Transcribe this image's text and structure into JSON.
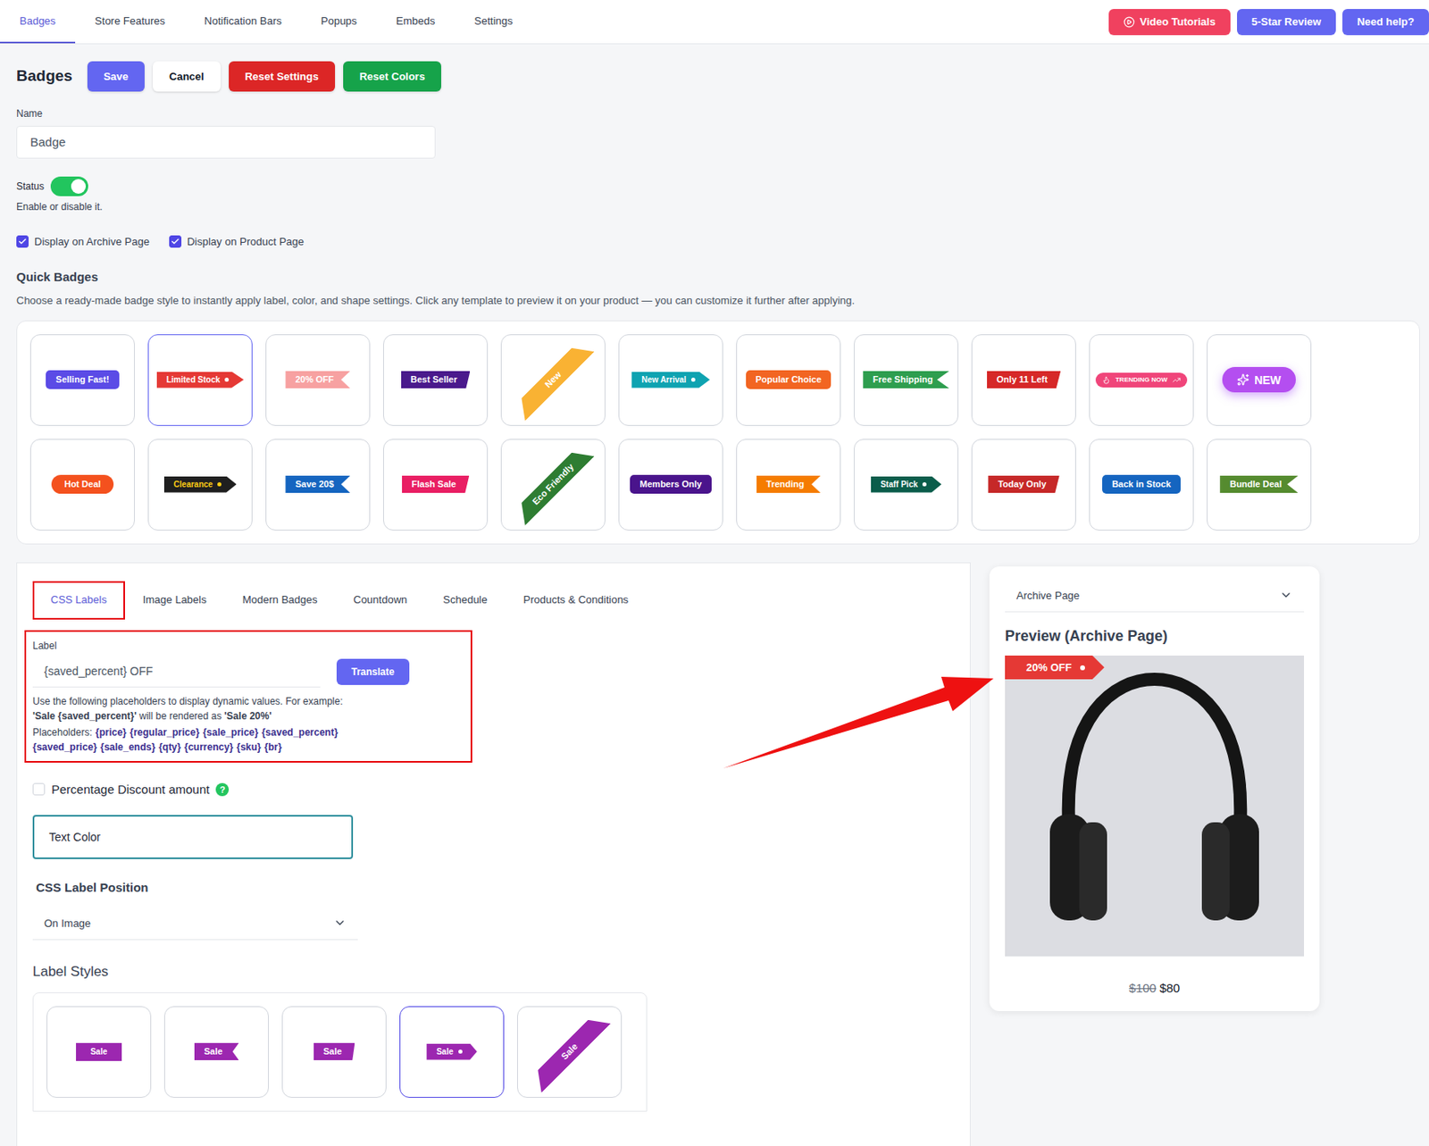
{
  "nav": {
    "tabs": [
      {
        "label": "Badges",
        "selected": true
      },
      {
        "label": "Store Features",
        "selected": false
      },
      {
        "label": "Notification Bars",
        "selected": false
      },
      {
        "label": "Popups",
        "selected": false
      },
      {
        "label": "Embeds",
        "selected": false
      },
      {
        "label": "Settings",
        "selected": false
      }
    ],
    "actions": [
      {
        "label": "Video Tutorials",
        "color": "#f0415f"
      },
      {
        "label": "5-Star Review",
        "color": "#6366f1"
      },
      {
        "label": "Need help?",
        "color": "#6366f1"
      }
    ]
  },
  "header": {
    "title": "Badges",
    "buttons": [
      {
        "label": "Save",
        "color": "#6366f1",
        "text_color": "#ffffff"
      },
      {
        "label": "Cancel",
        "color": "#ffffff",
        "text_color": "#111827"
      },
      {
        "label": "Reset Settings",
        "color": "#dc2626",
        "text_color": "#ffffff"
      },
      {
        "label": "Reset Colors",
        "color": "#16a34a",
        "text_color": "#ffffff"
      }
    ]
  },
  "name_field": {
    "label": "Name",
    "value": "Badge"
  },
  "status": {
    "label": "Status",
    "on": true,
    "hint": "Enable or disable it."
  },
  "display_options": [
    {
      "label": "Display on Archive Page",
      "checked": true
    },
    {
      "label": "Display on Product Page",
      "checked": true
    }
  ],
  "quick_badges": {
    "title": "Quick Badges",
    "description": "Choose a ready-made badge style to instantly apply label, color, and shape settings. Click any template to preview it on your product — you can customize it further after applying.",
    "items": [
      {
        "label": "Selling Fast!",
        "kind": "rounded",
        "color": "#5b4be6",
        "text_color": "#ffffff",
        "selected": false
      },
      {
        "label": "Limited Stock",
        "kind": "arrow",
        "color": "#e53935",
        "text_color": "#ffffff",
        "selected": true
      },
      {
        "label": "20% OFF",
        "kind": "notch",
        "color": "#f7a1a1",
        "text_color": "#ffffff",
        "selected": false
      },
      {
        "label": "Best Seller",
        "kind": "slant",
        "color": "#4a1a8c",
        "text_color": "#ffffff",
        "selected": false
      },
      {
        "label": "New",
        "kind": "corner",
        "color": "#f9b233",
        "text_color": "#ffffff",
        "selected": false
      },
      {
        "label": "New Arrival",
        "kind": "arrow",
        "color": "#0fa3b1",
        "text_color": "#ffffff",
        "selected": false
      },
      {
        "label": "Popular Choice",
        "kind": "rounded",
        "color": "#f26522",
        "text_color": "#ffffff",
        "selected": false
      },
      {
        "label": "Free Shipping",
        "kind": "notch",
        "color": "#2e9e4f",
        "text_color": "#ffffff",
        "selected": false
      },
      {
        "label": "Only 11 Left",
        "kind": "slant",
        "color": "#d62828",
        "text_color": "#ffffff",
        "selected": false
      },
      {
        "label": "TRENDING NOW",
        "kind": "pill-icons",
        "color": "#f0457a",
        "text_color": "#ffffff",
        "selected": false
      },
      {
        "label": "NEW",
        "kind": "pill-glow",
        "color": "#b44ef0",
        "text_color": "#ffffff",
        "selected": false
      },
      {
        "label": "Hot Deal",
        "kind": "pill",
        "color": "#f4511e",
        "text_color": "#ffffff",
        "selected": false
      },
      {
        "label": "Clearance",
        "kind": "arrow",
        "color": "#1f1f1f",
        "text_color": "#facc15",
        "selected": false
      },
      {
        "label": "Save 20$",
        "kind": "notch",
        "color": "#1565c0",
        "text_color": "#ffffff",
        "selected": false
      },
      {
        "label": "Flash Sale",
        "kind": "slant",
        "color": "#e91e63",
        "text_color": "#ffffff",
        "selected": false
      },
      {
        "label": "Eco Friendly",
        "kind": "corner",
        "color": "#2e7d32",
        "text_color": "#ffffff",
        "selected": false
      },
      {
        "label": "Members Only",
        "kind": "rounded",
        "color": "#4a148c",
        "text_color": "#ffffff",
        "selected": false
      },
      {
        "label": "Trending",
        "kind": "notch",
        "color": "#f57c00",
        "text_color": "#ffffff",
        "selected": false
      },
      {
        "label": "Staff Pick",
        "kind": "arrow",
        "color": "#0b5d4b",
        "text_color": "#ffffff",
        "selected": false
      },
      {
        "label": "Today Only",
        "kind": "slant",
        "color": "#c62828",
        "text_color": "#ffffff",
        "selected": false
      },
      {
        "label": "Back in Stock",
        "kind": "rounded",
        "color": "#1565c0",
        "text_color": "#ffffff",
        "selected": false
      },
      {
        "label": "Bundle Deal",
        "kind": "notch",
        "color": "#558b2f",
        "text_color": "#ffffff",
        "selected": false
      }
    ]
  },
  "editor_tabs": [
    {
      "label": "CSS Labels",
      "selected": true
    },
    {
      "label": "Image Labels",
      "selected": false
    },
    {
      "label": "Modern Badges",
      "selected": false
    },
    {
      "label": "Countdown",
      "selected": false
    },
    {
      "label": "Schedule",
      "selected": false
    },
    {
      "label": "Products & Conditions",
      "selected": false
    }
  ],
  "label_field": {
    "label": "Label",
    "value": "{saved_percent} OFF",
    "button": "Translate",
    "help_intro": "Use the following placeholders to display dynamic values. For example:",
    "example_source": "'Sale {saved_percent}'",
    "example_middle": " will be rendered as ",
    "example_result": "'Sale 20%'",
    "placeholders_label": "Placeholders:",
    "placeholders": [
      "{price}",
      "{regular_price}",
      "{sale_price}",
      "{saved_percent}",
      "{saved_price}",
      "{sale_ends}",
      "{qty}",
      "{currency}",
      "{sku}",
      "{br}"
    ]
  },
  "percentage_discount": {
    "label": "Percentage Discount amount",
    "checked": false,
    "help": "?"
  },
  "text_color": {
    "label": "Text Color"
  },
  "position": {
    "label": "CSS Label Position",
    "value": "On Image"
  },
  "label_styles": {
    "title": "Label Styles",
    "color": "#9c27b0",
    "items": [
      {
        "label": "Sale",
        "kind": "rect",
        "selected": false
      },
      {
        "label": "Sale",
        "kind": "notch",
        "selected": false
      },
      {
        "label": "Sale",
        "kind": "slant",
        "selected": false
      },
      {
        "label": "Sale",
        "kind": "arrow",
        "selected": true
      },
      {
        "label": "Sale",
        "kind": "corner",
        "selected": false
      }
    ]
  },
  "preview": {
    "page_select": "Archive Page",
    "title": "Preview (Archive Page)",
    "badge": {
      "label": "20% OFF",
      "color": "#e53935"
    },
    "regular_price": "$100",
    "sale_price": "$80"
  }
}
